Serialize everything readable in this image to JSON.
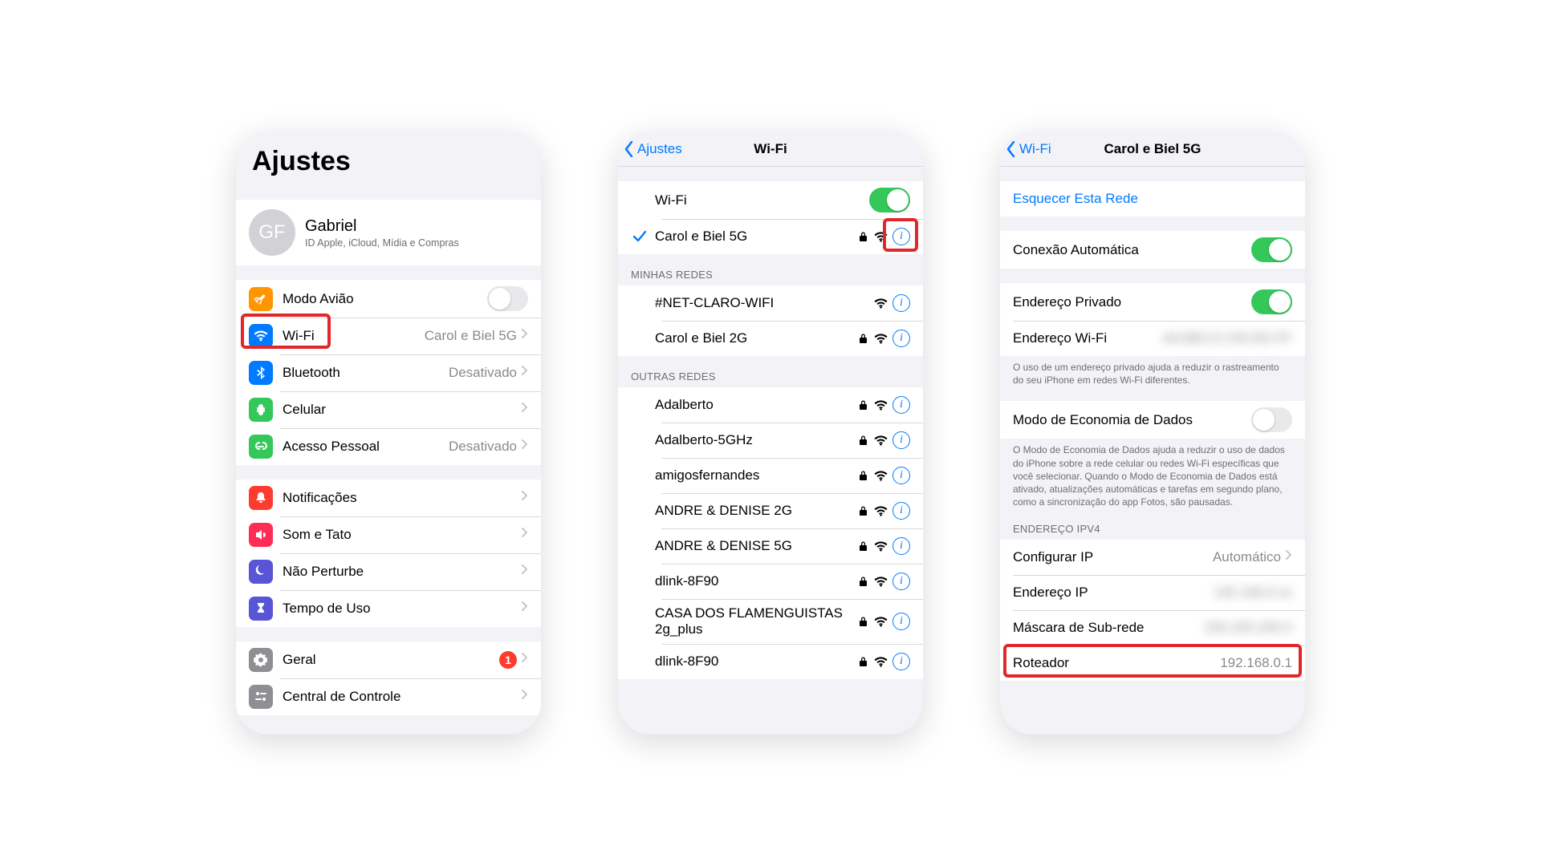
{
  "phone1": {
    "title": "Ajustes",
    "profile": {
      "initials": "GF",
      "name": "Gabriel",
      "sub": "ID Apple, iCloud, Mídia e Compras"
    },
    "rows": {
      "airplane": "Modo Avião",
      "wifi": "Wi-Fi",
      "wifi_val": "Carol e Biel 5G",
      "bluetooth": "Bluetooth",
      "bt_val": "Desativado",
      "cellular": "Celular",
      "hotspot": "Acesso Pessoal",
      "hotspot_val": "Desativado",
      "notif": "Notificações",
      "sound": "Som e Tato",
      "dnd": "Não Perturbe",
      "screentime": "Tempo de Uso",
      "general": "Geral",
      "general_badge": "1",
      "control": "Central de Controle"
    }
  },
  "phone2": {
    "back": "Ajustes",
    "title": "Wi-Fi",
    "wifi_label": "Wi-Fi",
    "connected": "Carol e Biel 5G",
    "section_my": "MINHAS REDES",
    "my": [
      {
        "name": "#NET-CLARO-WIFI",
        "locked": false
      },
      {
        "name": "Carol e Biel 2G",
        "locked": true
      }
    ],
    "section_other": "OUTRAS REDES",
    "other": [
      {
        "name": "Adalberto",
        "locked": true
      },
      {
        "name": "Adalberto-5GHz",
        "locked": true
      },
      {
        "name": "amigosfernandes",
        "locked": true
      },
      {
        "name": "ANDRE & DENISE 2G",
        "locked": true
      },
      {
        "name": "ANDRE & DENISE 5G",
        "locked": true
      },
      {
        "name": "dlink-8F90",
        "locked": true
      },
      {
        "name": "CASA DOS FLAMENGUISTAS 2g_plus",
        "locked": true
      },
      {
        "name": "dlink-8F90",
        "locked": true
      }
    ]
  },
  "phone3": {
    "back": "Wi-Fi",
    "title": "Carol e Biel 5G",
    "forget": "Esquecer Esta Rede",
    "auto": "Conexão Automática",
    "priv": "Endereço Privado",
    "wifiaddr": "Endereço Wi-Fi",
    "priv_footer": "O uso de um endereço privado ajuda a reduzir o rastreamento do seu iPhone em redes Wi-Fi diferentes.",
    "lowdata": "Modo de Economia de Dados",
    "lowdata_footer": "O Modo de Economia de Dados ajuda a reduzir o uso de dados do iPhone sobre a rede celular ou redes Wi-Fi específicas que você selecionar. Quando o Modo de Economia de Dados está ativado, atualizações automáticas e tarefas em segundo plano, como a sincronização do app Fotos, são pausadas.",
    "ipv4_header": "ENDEREÇO IPV4",
    "configip": "Configurar IP",
    "configip_val": "Automático",
    "ipaddr": "Endereço IP",
    "mask": "Máscara de Sub-rede",
    "router": "Roteador",
    "router_val": "192.168.0.1"
  }
}
